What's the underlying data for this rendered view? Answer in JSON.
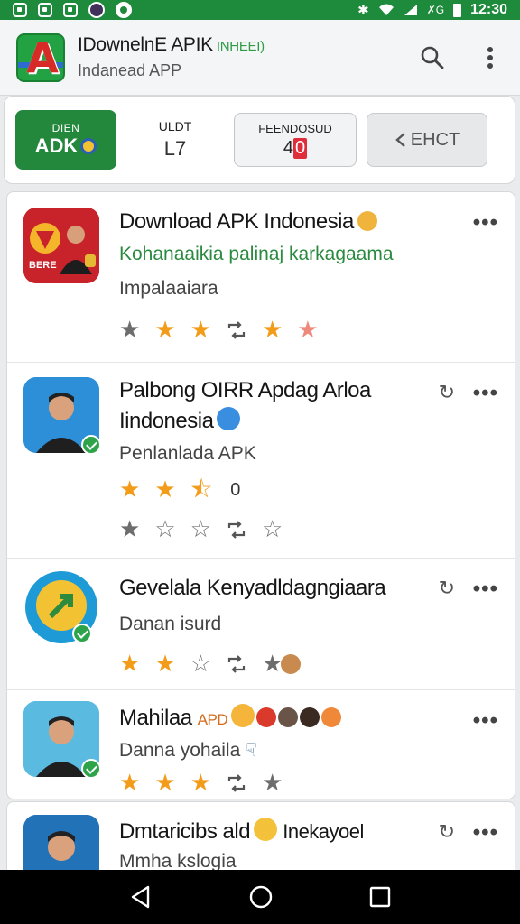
{
  "status_bar": {
    "time": "12:30"
  },
  "header": {
    "title": "IDownelnE APIK",
    "title_highlight": "INHEEI)",
    "subtitle": "Indanead APP"
  },
  "toolbar": {
    "apk_top": "DIEN",
    "apk_main": "ADK",
    "stat_label": "ULDT",
    "stat_value": "L7",
    "box_label": "FEENDOSUD",
    "box_value_prefix": "4",
    "box_value_badge": "0",
    "share_label": "EHCT"
  },
  "items": [
    {
      "title": "Download APK Indonesia",
      "subtitle": "Kohanaaikia palinaj karkagaama",
      "subtitle_color": "green",
      "line3": "Impalaaiara",
      "icon_label": "BERE"
    },
    {
      "title_line1": "Palbong OIRR Apdag Arloa",
      "title_line2": "Iindonesia",
      "subtitle": "Penlanlada APK",
      "rating": "0"
    },
    {
      "title": "Gevelala Kenyadldagngiaara",
      "subtitle": "Danan isurd"
    },
    {
      "title": "Mahilaa",
      "title_tag": "APD",
      "subtitle": "Danna yohaila"
    },
    {
      "title": "Dmtaricibs ald",
      "title_suffix": "Inekayoel",
      "subtitle": "Mmha kslogia"
    }
  ],
  "colors": {
    "accent": "#23883c",
    "status_bar": "#1e8a3c",
    "star": "#f39c1a"
  }
}
